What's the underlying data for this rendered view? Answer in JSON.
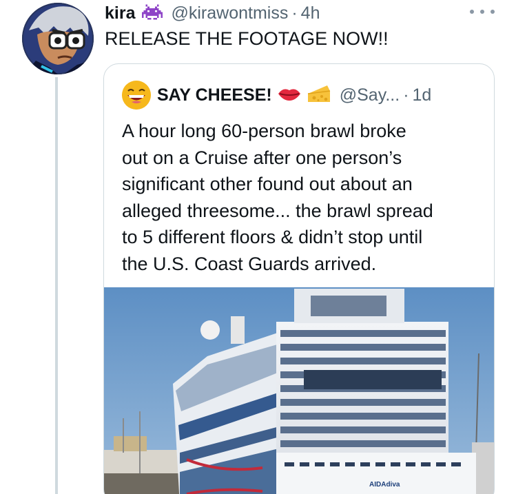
{
  "tweet": {
    "name": "kira",
    "handle": "@kirawontmiss",
    "separator": "·",
    "time": "4h",
    "text": "RELEASE THE FOOTAGE NOW!!",
    "name_emoji_icon": "space-invader-icon"
  },
  "quote": {
    "name": "SAY CHEESE!",
    "handle": "@Say...",
    "separator": "·",
    "time": "1d",
    "name_emoji_icons": [
      "lips-icon",
      "cheese-icon"
    ],
    "text_lines": [
      "A hour long 60-person brawl broke",
      "out on a Cruise after one person’s",
      "significant other found out about an",
      "alleged threesome... the brawl spread",
      "to 5 different floors & didn’t stop until",
      "the U.S. Coast Guards arrived."
    ],
    "media": {
      "ship_lettering": "AIDAdiva"
    }
  },
  "colors": {
    "text_primary": "#0f1419",
    "text_secondary": "#536471",
    "border": "#cfd9de",
    "emoji_purple": "#8e44c7",
    "sky": "#6f9cc8"
  }
}
